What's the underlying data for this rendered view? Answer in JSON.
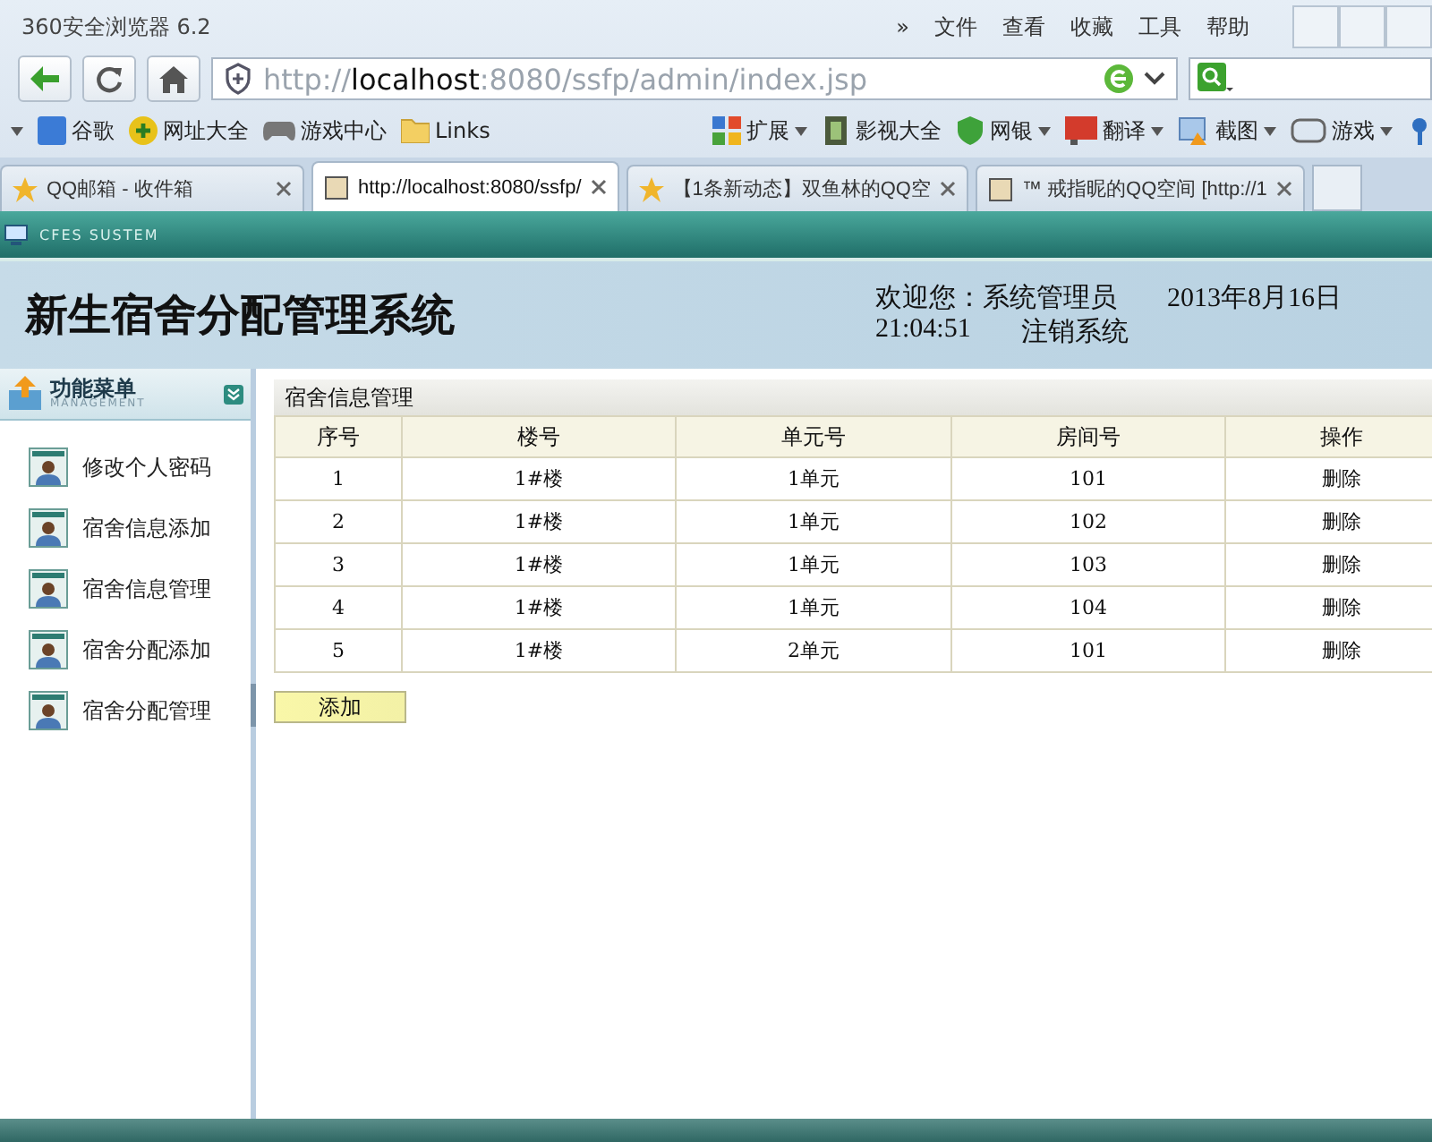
{
  "browser": {
    "title": "360安全浏览器 6.2",
    "menu": [
      "»",
      "文件",
      "查看",
      "收藏",
      "工具",
      "帮助"
    ],
    "url": {
      "scheme": "http://",
      "host": "localhost",
      "path": ":8080/ssfp/admin/index.jsp"
    },
    "bookmarks": [
      {
        "label": "谷歌",
        "has_menu": false
      },
      {
        "label": "网址大全",
        "has_menu": false
      },
      {
        "label": "游戏中心",
        "has_menu": false
      },
      {
        "label": "Links",
        "has_menu": false
      }
    ],
    "tools": [
      {
        "label": "扩展",
        "has_menu": true
      },
      {
        "label": "影视大全",
        "has_menu": false
      },
      {
        "label": "网银",
        "has_menu": true
      },
      {
        "label": "翻译",
        "has_menu": true
      },
      {
        "label": "截图",
        "has_menu": true
      },
      {
        "label": "游戏",
        "has_menu": true
      }
    ],
    "tabs": [
      {
        "label": "QQ邮箱 - 收件箱",
        "selected": false
      },
      {
        "label": "http://localhost:8080/ssfp/",
        "selected": true
      },
      {
        "label": "【1条新动态】双鱼林的QQ空",
        "selected": false
      },
      {
        "label": "™ 戒指昵的QQ空间 [http://1",
        "selected": false
      }
    ]
  },
  "app": {
    "system_label": "CFES SUSTEM",
    "title": "新生宿舍分配管理系统",
    "welcome": "欢迎您：系统管理员",
    "date": "2013年8月16日",
    "time": "21:04:51",
    "logout": "注销系统"
  },
  "sidebar": {
    "title": "功能菜单",
    "subtitle": "MANAGEMENT",
    "items": [
      {
        "label": "修改个人密码",
        "selected": false
      },
      {
        "label": "宿舍信息添加",
        "selected": false
      },
      {
        "label": "宿舍信息管理",
        "selected": false
      },
      {
        "label": "宿舍分配添加",
        "selected": false
      },
      {
        "label": "宿舍分配管理",
        "selected": false
      }
    ]
  },
  "panel": {
    "title": "宿舍信息管理",
    "table": {
      "columns": [
        "序号",
        "楼号",
        "单元号",
        "房间号",
        "操作"
      ],
      "rows": [
        {
          "cells": [
            "1",
            "1#楼",
            "1单元",
            "101"
          ],
          "action": "删除"
        },
        {
          "cells": [
            "2",
            "1#楼",
            "1单元",
            "102"
          ],
          "action": "删除"
        },
        {
          "cells": [
            "3",
            "1#楼",
            "1单元",
            "103"
          ],
          "action": "删除"
        },
        {
          "cells": [
            "4",
            "1#楼",
            "1单元",
            "104"
          ],
          "action": "删除"
        },
        {
          "cells": [
            "5",
            "1#楼",
            "2单元",
            "101"
          ],
          "action": "删除"
        }
      ]
    },
    "add_button": "添加"
  }
}
